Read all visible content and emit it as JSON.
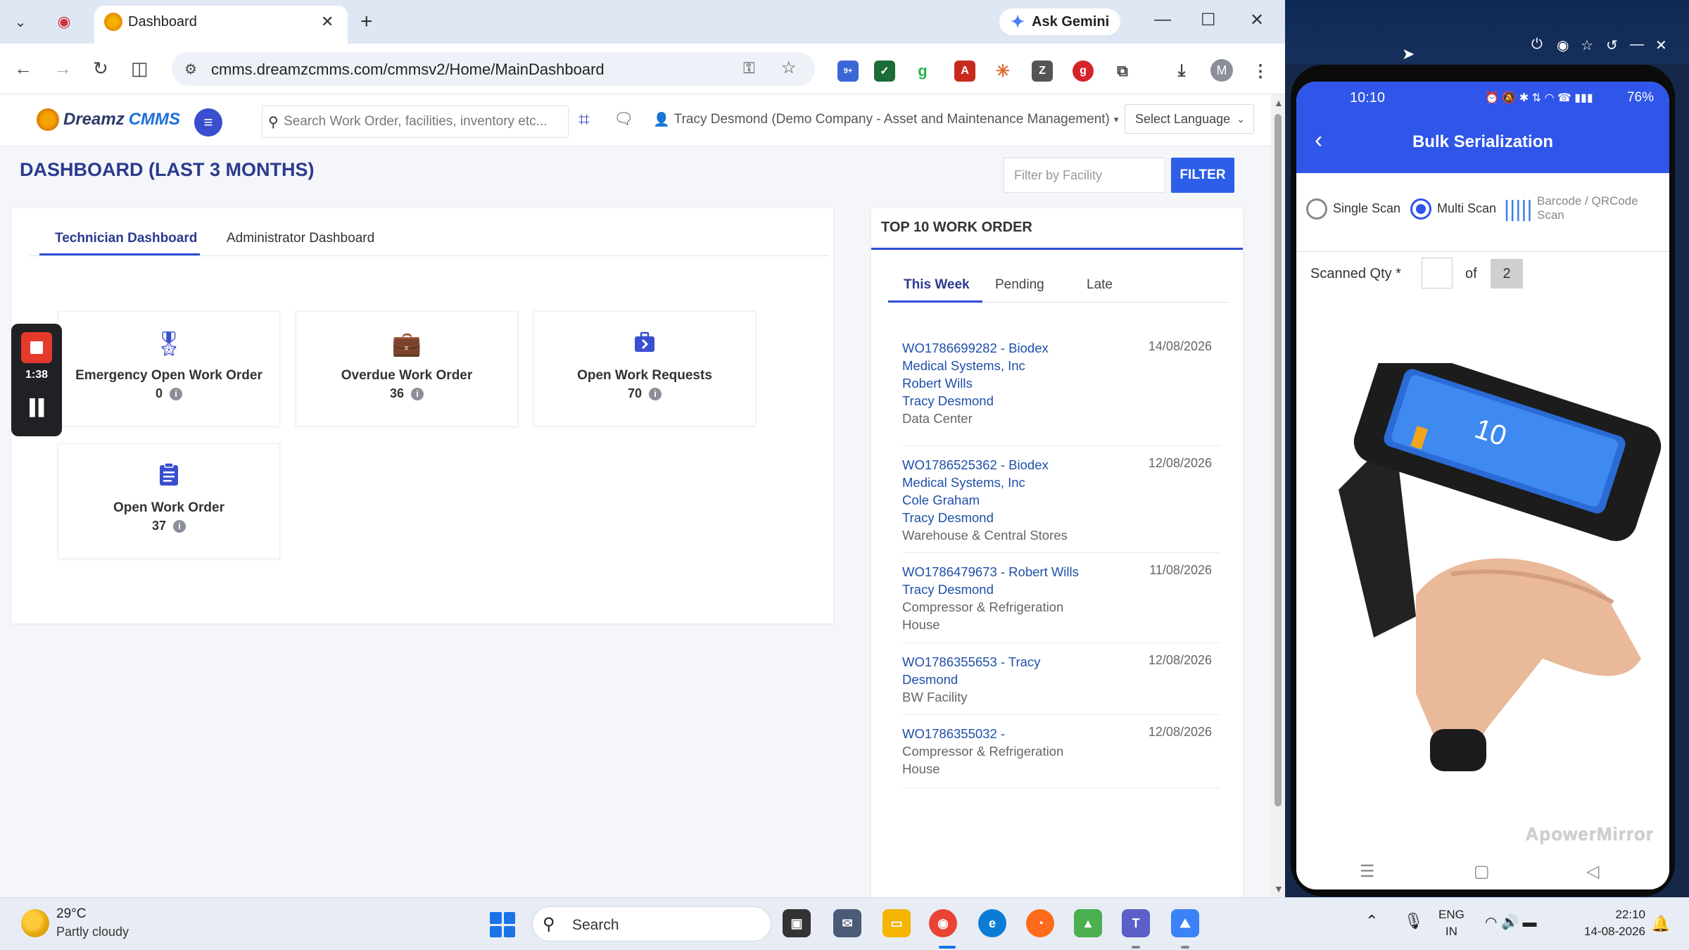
{
  "browser": {
    "tab_title": "Dashboard",
    "ask_gemini": "Ask Gemini",
    "url": "cmms.dreamzcmms.com/cmmsv2/Home/MainDashboard",
    "extension_badge": "9+",
    "profile_initial": "M"
  },
  "app": {
    "logo_part1": "Dreamz",
    "logo_part2": "CMMS",
    "search_placeholder": "Search Work Order, facilities, inventory etc...",
    "user_label": "Tracy Desmond (Demo Company - Asset and Maintenance Management)",
    "language_select": "Select Language"
  },
  "dashboard": {
    "title": "DASHBOARD (LAST 3 MONTHS)",
    "facility_filter_placeholder": "Filter by Facility",
    "filter_button": "FILTER",
    "tabs": [
      "Technician Dashboard",
      "Administrator Dashboard"
    ],
    "tiles": [
      {
        "label": "Emergency Open Work Order",
        "value": "0",
        "icon": "award-ribbon-icon"
      },
      {
        "label": "Overdue Work Order",
        "value": "36",
        "icon": "briefcase-icon"
      },
      {
        "label": "Open Work Requests",
        "value": "70",
        "icon": "briefcase-arrow-icon"
      },
      {
        "label": "Open Work Order",
        "value": "37",
        "icon": "clipboard-list-icon"
      }
    ]
  },
  "recorder": {
    "time": "1:38"
  },
  "top_work_orders": {
    "title": "TOP 10 WORK ORDER",
    "tabs": [
      "This Week",
      "Pending",
      "Late"
    ],
    "items": [
      {
        "lines": [
          "WO1786699282 - Biodex Medical Systems, Inc",
          "Robert Wills",
          "Tracy Desmond"
        ],
        "location": "Data Center",
        "date": "14/08/2026"
      },
      {
        "lines": [
          "WO1786525362 - Biodex Medical Systems, Inc",
          "Cole Graham",
          "Tracy Desmond"
        ],
        "location": "Warehouse & Central Stores",
        "date": "12/08/2026"
      },
      {
        "lines": [
          "WO1786479673 - Robert Wills",
          "Tracy Desmond"
        ],
        "location": "Compressor & Refrigeration House",
        "date": "11/08/2026"
      },
      {
        "lines": [
          "WO1786355653 - Tracy Desmond"
        ],
        "location": "BW Facility",
        "date": "12/08/2026"
      },
      {
        "lines": [
          "WO1786355032 -"
        ],
        "location": "Compressor & Refrigeration House",
        "date": "12/08/2026"
      }
    ]
  },
  "phone": {
    "status_time": "10:10",
    "battery": "76%",
    "title": "Bulk Serialization",
    "scan_modes": [
      "Single Scan",
      "Multi Scan"
    ],
    "selected_mode": "Multi Scan",
    "barcode_label": "Barcode / QRCode Scan",
    "scanned_qty_label": "Scanned Qty *",
    "scanned_qty_value": "",
    "of_label": "of",
    "total_qty": "2",
    "watermark": "ApowerMirror"
  },
  "taskbar": {
    "temperature": "29°C",
    "weather": "Partly cloudy",
    "search_label": "Search",
    "lang_line1": "ENG",
    "lang_line2": "IN",
    "time": "22:10",
    "date": "14-08-2026"
  }
}
